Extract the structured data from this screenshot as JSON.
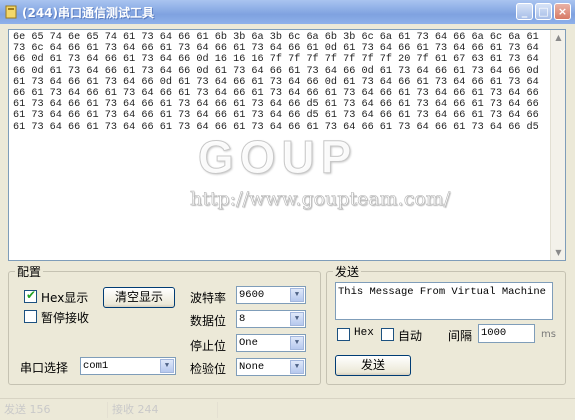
{
  "window": {
    "title": "(244)串口通信测试工具",
    "buttons": {
      "minimize": "_",
      "maximize": "□",
      "close": "×"
    }
  },
  "hex_view": {
    "content": "6e 65 74 6e 65 74 61 73 64 66 61 6b 3b 6a 3b 6c 6a 6b 3b 6c 6a 61 73 64 66 6a 6c 6a 61 73 6c 64 66 61 73 64 66 61 73 64 66 61 73 64 66 61 0d 61 73 64 66 61 73 64 66 61 73 64 66 0d 61 73 64 66 61 73 64 66 0d 16 16 16 7f 7f 7f 7f 7f 7f 7f 20 7f 61 67 63 61 73 64 66 0d 61 73 64 66 61 73 64 66 0d 61 73 64 66 61 73 64 66 0d 61 73 64 66 61 73 64 66 0d 61 73 64 66 61 73 64 66 0d 61 73 64 66 61 73 64 66 0d 61 73 64 66 61 73 64 66 61 73 64 66 61 73 64 66 61 73 64 66 61 73 64 66 61 73 64 66 61 73 64 66 61 73 64 66 61 73 64 66 61 73 64 66 61 73 64 66 61 73 64 66 61 73 64 66 d5 61 73 64 66 61 73 64 66 61 73 64 66 61 73 64 66 61 73 64 66 61 73 64 66 61 73 64 66 d5 61 73 64 66 61 73 64 66 61 73 64 66 61 73 64 66 61 73 64 66 61 73 64 66 61 73 64 66 61 73 64 66 61 73 64 66 61 73 64 66 d5"
  },
  "watermark": {
    "logo": "GOUP",
    "url": "http://www.goupteam.com/"
  },
  "config": {
    "legend": "配置",
    "hex_display": {
      "label": "Hex显示",
      "checked": true
    },
    "pause_receive": {
      "label": "暂停接收",
      "checked": false
    },
    "clear_button": "清空显示",
    "baud_label": "波特率",
    "baud_value": "9600",
    "databits_label": "数据位",
    "databits_value": "8",
    "stopbits_label": "停止位",
    "stopbits_value": "One",
    "port_label": "串口选择",
    "port_value": "com1",
    "parity_label": "检验位",
    "parity_value": "None"
  },
  "send": {
    "legend": "发送",
    "message": "This Message From Virtual Machine",
    "hex_label": "Hex",
    "auto_label": "自动",
    "interval_label": "间隔",
    "interval_value": "1000",
    "interval_unit": "ms",
    "send_button": "发送"
  },
  "status": {
    "sent": "发送 156",
    "received": "接收 244"
  },
  "icons": {
    "app": "app-icon",
    "dropdown": "chevron-down-icon",
    "scroll_up": "scroll-up-icon",
    "scroll_down": "scroll-down-icon"
  }
}
